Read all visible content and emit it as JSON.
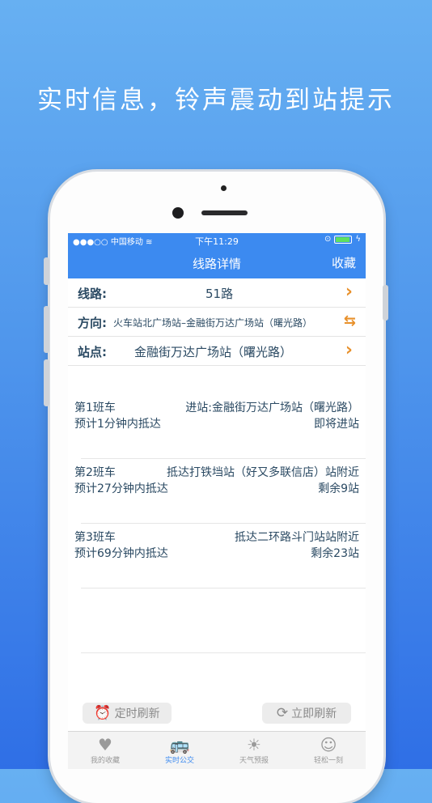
{
  "headline": "实时信息，铃声震动到站提示",
  "status": {
    "signal": "●●●○○",
    "carrier": "中国移动",
    "time": "下午11:29"
  },
  "nav": {
    "title": "线路详情",
    "favorite": "收藏"
  },
  "route": {
    "label": "线路:",
    "value": "51路"
  },
  "direction": {
    "label": "方向:",
    "value": "火车站北广场站–金融街万达广场站（曙光路）"
  },
  "station": {
    "label": "站点:",
    "value": "金融街万达广场站（曙光路）"
  },
  "buses": [
    {
      "name": "第1班车",
      "location": "进站:金融街万达广场站（曙光路）",
      "eta": "预计1分钟内抵达",
      "remaining": "即将进站"
    },
    {
      "name": "第2班车",
      "location": "抵达打铁垱站（好又多联信店）站附近",
      "eta": "预计27分钟内抵达",
      "remaining": "剩余9站"
    },
    {
      "name": "第3班车",
      "location": "抵达二环路斗门站站附近",
      "eta": "预计69分钟内抵达",
      "remaining": "剩余23站"
    }
  ],
  "buttons": {
    "timed_refresh": "定时刷新",
    "refresh_now": "立即刷新"
  },
  "tabs": [
    {
      "label": "我的收藏",
      "icon": "heart-icon"
    },
    {
      "label": "实时公交",
      "icon": "bus-icon"
    },
    {
      "label": "天气预报",
      "icon": "sun-icon"
    },
    {
      "label": "轻松一刻",
      "icon": "smile-icon"
    }
  ],
  "colors": {
    "accent": "#3c8af0",
    "arrow": "#e8912c",
    "text": "#2b4a63"
  }
}
